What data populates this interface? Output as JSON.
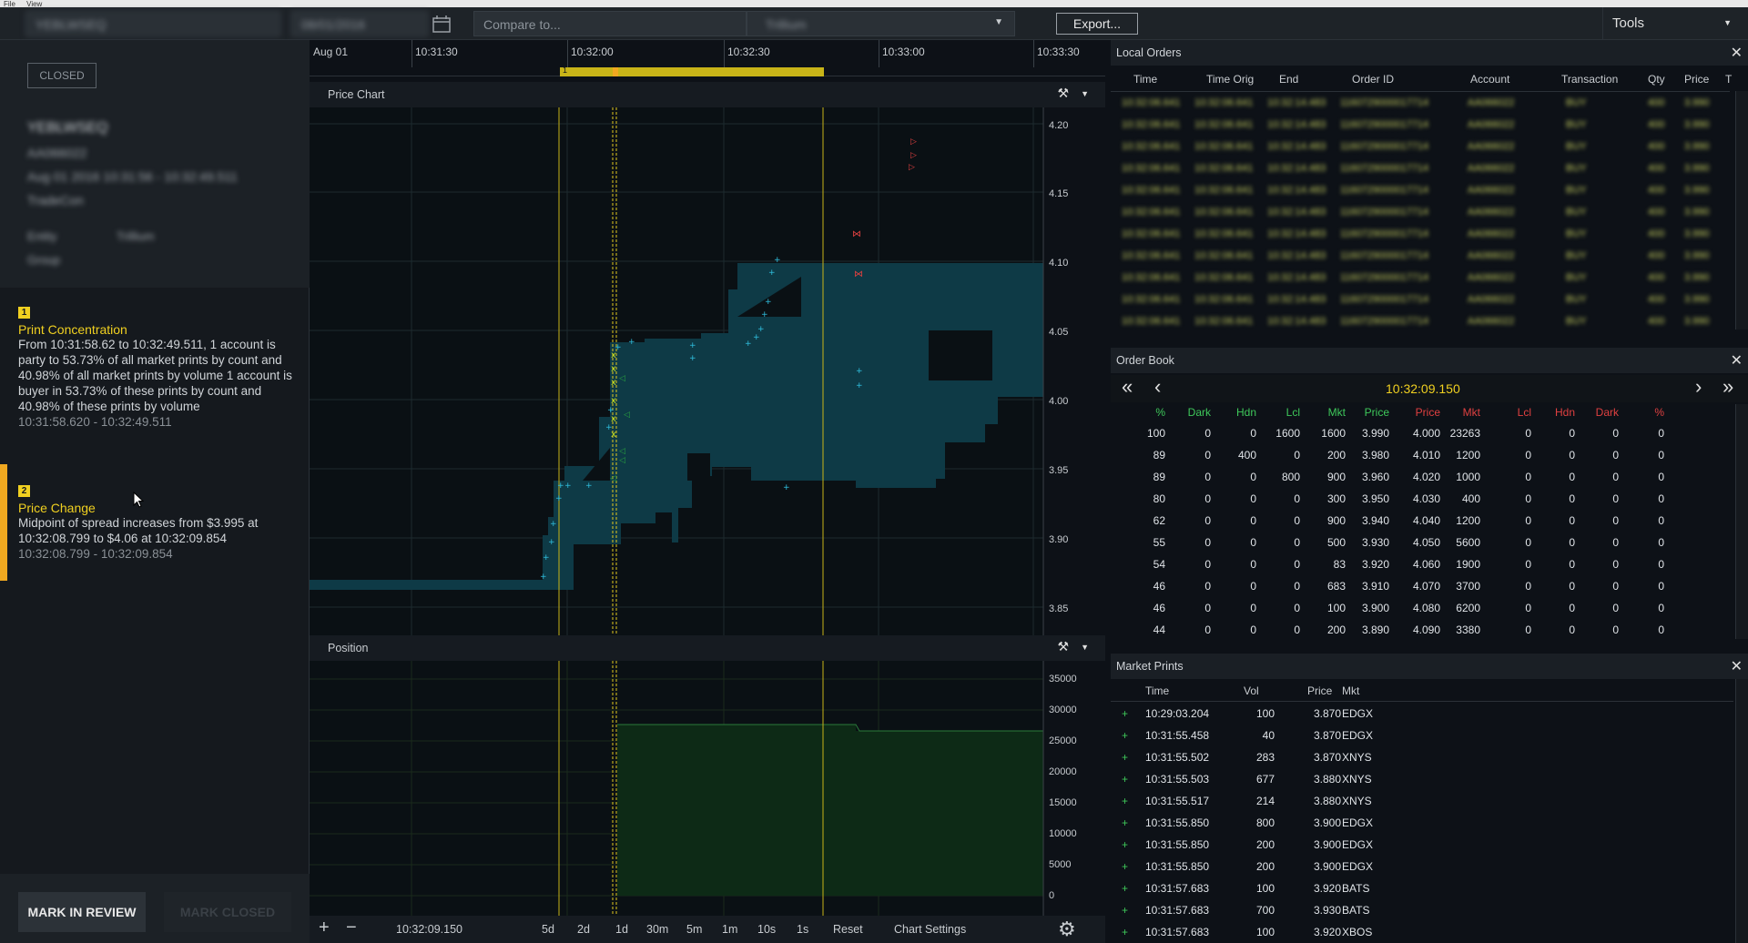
{
  "menubar": {
    "file": "File",
    "view": "View"
  },
  "topbar": {
    "case_id": "YEBLWSEQ",
    "date": "08/01/2016",
    "compare_placeholder": "Compare to...",
    "entity": "Trillium",
    "export_label": "Export...",
    "tools_label": "Tools"
  },
  "case": {
    "status": "CLOSED",
    "title": "YEBLWSEQ",
    "account": "AA066022",
    "range": "Aug 01 2016 10:31:56 - 10:32:49.511",
    "type": "TradeCon",
    "entity_label": "Entity",
    "entity_value": "Trillium",
    "group_label": "Group"
  },
  "alerts": [
    {
      "num": "1",
      "title": "Print Concentration",
      "desc": "From 10:31:58.62 to 10:32:49.511, 1 account is party to 53.73% of all market prints by count and 40.98% of all market prints by volume 1 account is buyer in 53.73% of these prints by count and 40.98% of these prints by volume",
      "time": "10:31:58.620 - 10:32:49.511"
    },
    {
      "num": "2",
      "title": "Price Change",
      "desc": "Midpoint of spread increases from $3.995 at 10:32:08.799 to $4.06 at 10:32:09.854",
      "time": "10:32:08.799 - 10:32:09.854"
    }
  ],
  "buttons": {
    "mark_review": "MARK IN REVIEW",
    "mark_closed": "MARK CLOSED"
  },
  "timeline": {
    "labels": [
      "Aug 01",
      "10:31:30",
      "10:32:00",
      "10:32:30",
      "10:33:00",
      "10:33:30"
    ],
    "marker": "1"
  },
  "price_chart": {
    "title": "Price Chart",
    "y_ticks": [
      "4.20",
      "4.15",
      "4.10",
      "4.05",
      "4.00",
      "3.95",
      "3.90",
      "3.85"
    ]
  },
  "position_chart": {
    "title": "Position",
    "y_ticks": [
      "35000",
      "30000",
      "25000",
      "20000",
      "15000",
      "10000",
      "5000",
      "0"
    ]
  },
  "chart_controls": {
    "plus": "+",
    "minus": "−",
    "current_time": "10:32:09.150",
    "ranges": [
      "5d",
      "2d",
      "1d",
      "30m",
      "5m",
      "1m",
      "10s",
      "1s"
    ],
    "reset": "Reset",
    "settings": "Chart Settings"
  },
  "local_orders": {
    "title": "Local Orders",
    "columns": [
      "Time",
      "Time Orig",
      "End",
      "Order ID",
      "Account",
      "Transaction",
      "Qty",
      "Price",
      "T"
    ],
    "blurred_row": [
      "10:32:06.641",
      "10:32:06.641",
      "10:32:14.483",
      "1160729000017714",
      "AA066022",
      "BUY",
      "400",
      "3.990"
    ]
  },
  "order_book": {
    "title": "Order Book",
    "time": "10:32:09.150",
    "nav": {
      "first": "«",
      "prev": "‹",
      "next": "›",
      "last": "»"
    },
    "columns": [
      "%",
      "Dark",
      "Hdn",
      "Lcl",
      "Mkt",
      "Price",
      "Price",
      "Mkt",
      "Lcl",
      "Hdn",
      "Dark",
      "%"
    ],
    "rows": [
      [
        "100",
        "0",
        "0",
        "1600",
        "1600",
        "3.990",
        "4.000",
        "23263",
        "0",
        "0",
        "0",
        "0"
      ],
      [
        "89",
        "0",
        "400",
        "0",
        "200",
        "3.980",
        "4.010",
        "1200",
        "0",
        "0",
        "0",
        "0"
      ],
      [
        "89",
        "0",
        "0",
        "800",
        "900",
        "3.960",
        "4.020",
        "1000",
        "0",
        "0",
        "0",
        "0"
      ],
      [
        "80",
        "0",
        "0",
        "0",
        "300",
        "3.950",
        "4.030",
        "400",
        "0",
        "0",
        "0",
        "0"
      ],
      [
        "62",
        "0",
        "0",
        "0",
        "900",
        "3.940",
        "4.040",
        "1200",
        "0",
        "0",
        "0",
        "0"
      ],
      [
        "55",
        "0",
        "0",
        "0",
        "500",
        "3.930",
        "4.050",
        "5600",
        "0",
        "0",
        "0",
        "0"
      ],
      [
        "54",
        "0",
        "0",
        "0",
        "83",
        "3.920",
        "4.060",
        "1900",
        "0",
        "0",
        "0",
        "0"
      ],
      [
        "46",
        "0",
        "0",
        "0",
        "683",
        "3.910",
        "4.070",
        "3700",
        "0",
        "0",
        "0",
        "0"
      ],
      [
        "46",
        "0",
        "0",
        "0",
        "100",
        "3.900",
        "4.080",
        "6200",
        "0",
        "0",
        "0",
        "0"
      ],
      [
        "44",
        "0",
        "0",
        "0",
        "200",
        "3.890",
        "4.090",
        "3380",
        "0",
        "0",
        "0",
        "0"
      ]
    ]
  },
  "market_prints": {
    "title": "Market Prints",
    "columns": [
      "Time",
      "Vol",
      "Price",
      "Mkt"
    ],
    "rows": [
      [
        "+",
        "10:29:03.204",
        "100",
        "3.870",
        "EDGX"
      ],
      [
        "+",
        "10:31:55.458",
        "40",
        "3.870",
        "EDGX"
      ],
      [
        "+",
        "10:31:55.502",
        "283",
        "3.870",
        "XNYS"
      ],
      [
        "+",
        "10:31:55.503",
        "677",
        "3.880",
        "XNYS"
      ],
      [
        "+",
        "10:31:55.517",
        "214",
        "3.880",
        "XNYS"
      ],
      [
        "+",
        "10:31:55.850",
        "800",
        "3.900",
        "EDGX"
      ],
      [
        "+",
        "10:31:55.850",
        "200",
        "3.900",
        "EDGX"
      ],
      [
        "+",
        "10:31:55.850",
        "200",
        "3.900",
        "EDGX"
      ],
      [
        "+",
        "10:31:57.683",
        "100",
        "3.920",
        "BATS"
      ],
      [
        "+",
        "10:31:57.683",
        "700",
        "3.930",
        "BATS"
      ],
      [
        "+",
        "10:31:57.683",
        "100",
        "3.920",
        "XBOS"
      ]
    ]
  },
  "colors": {
    "accent_yellow": "#f0d020",
    "alert_bar": "#f0a820",
    "bid_green": "#3ec85a",
    "ask_red": "#e04040",
    "book_time": "#f0d020"
  }
}
